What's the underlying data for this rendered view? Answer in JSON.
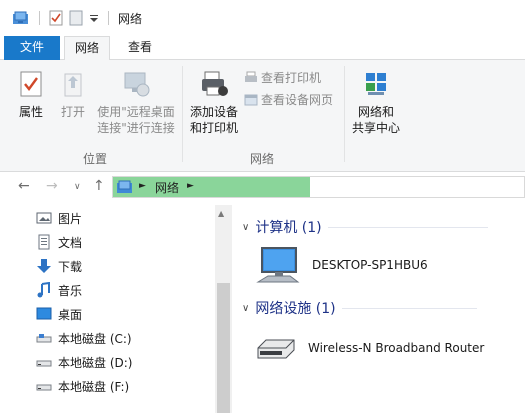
{
  "window": {
    "title": "网络"
  },
  "ribbon_tabs": {
    "file": "文件",
    "network": "网络",
    "view": "查看"
  },
  "ribbon": {
    "properties": "属性",
    "open": "打开",
    "remote_desktop_line1": "使用\"远程桌面",
    "remote_desktop_line2": "连接\"进行连接",
    "add_devices_line1": "添加设备",
    "add_devices_line2": "和打印机",
    "view_printers": "查看打印机",
    "view_device_webpage": "查看设备网页",
    "network_sharing_line1": "网络和",
    "network_sharing_line2": "共享中心",
    "group_location": "位置",
    "group_network": "网络"
  },
  "address": {
    "crumb": "网络"
  },
  "nav": {
    "items": [
      {
        "label": "图片",
        "icon": "pictures-icon"
      },
      {
        "label": "文档",
        "icon": "documents-icon"
      },
      {
        "label": "下载",
        "icon": "downloads-icon"
      },
      {
        "label": "音乐",
        "icon": "music-icon"
      },
      {
        "label": "桌面",
        "icon": "desktop-icon"
      },
      {
        "label": "本地磁盘 (C:)",
        "icon": "drive-icon"
      },
      {
        "label": "本地磁盘 (D:)",
        "icon": "drive-icon"
      },
      {
        "label": "本地磁盘 (F:)",
        "icon": "drive-icon"
      }
    ]
  },
  "content": {
    "computers_header": "计算机 (1)",
    "computer_name": "DESKTOP-SP1HBU6",
    "infra_header": "网络设施 (1)",
    "router_name": "Wireless-N Broadband Router"
  },
  "colors": {
    "file_tab": "#1979ca",
    "address_highlight": "#8ad59a",
    "section_header": "#1e3287"
  }
}
